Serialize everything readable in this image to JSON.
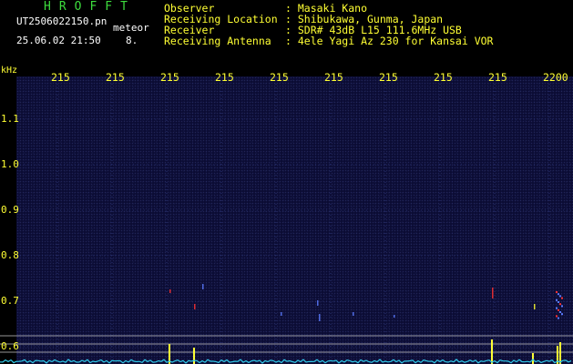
{
  "header": {
    "title": "HROFFT",
    "filename": "UT2506022150.pn",
    "meteor_label": "meteor",
    "datetime": "25.06.02 21:50",
    "count": "8."
  },
  "info": {
    "observer_label": "Observer",
    "observer_value": ": Masaki Kano",
    "location_label": "Receiving Location",
    "location_value": ": Shibukawa, Gunma, Japan",
    "receiver_label": "Receiver",
    "receiver_value": ": SDR# 43dB L15 111.6MHz USB",
    "antenna_label": "Receiving Antenna",
    "antenna_value": ": 4ele Yagi Az 230 for Kansai VOR"
  },
  "axis": {
    "unit": "kHz",
    "y_labels": [
      "1.1",
      "1.0",
      "0.9",
      "0.8",
      "0.7",
      "0.6"
    ],
    "time_labels": [
      "215",
      "215",
      "215",
      "215",
      "215",
      "215",
      "215",
      "215",
      "215",
      "2200"
    ]
  },
  "colors": {
    "background": "#0b0c34",
    "text_green": "#3ddc3d",
    "text_yellow": "#ffff33",
    "grid": "#2f3a80",
    "band_lines": "#c8c8c8",
    "echo_red": "#ff3030",
    "echo_blue": "#5a7aff",
    "trace_yellow": "#ffff33",
    "noise_cyan": "#30c8e8"
  }
}
